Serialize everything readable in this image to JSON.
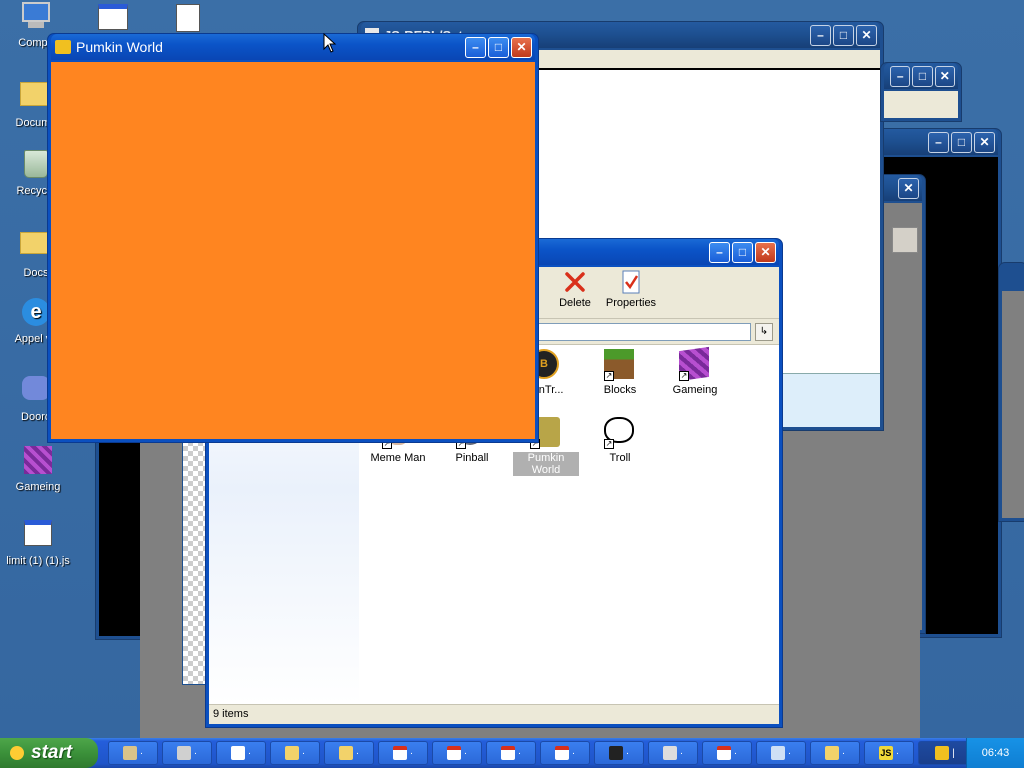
{
  "desktop": {
    "icons": [
      {
        "label": "Compu",
        "icon": "computer-icon"
      },
      {
        "label": "Docume",
        "icon": "documents-folder-icon"
      },
      {
        "label": "Recycle",
        "icon": "recycle-bin-icon"
      },
      {
        "label": "Docs",
        "icon": "folder-icon"
      },
      {
        "label": "Appel v1",
        "icon": "browser-icon"
      },
      {
        "label": "Doord",
        "icon": "discord-icon"
      },
      {
        "label": "Gameing",
        "icon": "purple-cube-icon"
      },
      {
        "label": "limit (1) (1).js",
        "icon": "script-file-icon"
      }
    ]
  },
  "windows": {
    "pumkin": {
      "title": "Pumkin World",
      "fill_color": "#FF8520"
    },
    "js_repl": {
      "title": "JS-REPL/Set"
    },
    "explorer": {
      "toolbar": [
        {
          "label": "Delete",
          "icon": "delete-x-icon"
        },
        {
          "label": "Properties",
          "icon": "properties-icon"
        }
      ],
      "files": [
        {
          "label": "oonTr...",
          "icon": "b-logo-icon"
        },
        {
          "label": "Blocks",
          "icon": "grass-block-icon"
        },
        {
          "label": "Gameing",
          "icon": "purple-cube-icon"
        },
        {
          "label": "Meme Man",
          "icon": "meme-man-icon"
        },
        {
          "label": "Pinball",
          "icon": "pinball-icon"
        },
        {
          "label": "Pumkin World",
          "icon": "pumpkin-icon"
        },
        {
          "label": "Troll",
          "icon": "troll-face-icon"
        }
      ],
      "status": "9 items"
    }
  },
  "taskbar": {
    "start_label": "start",
    "clock": "06:43",
    "items": [
      "",
      "",
      "",
      "",
      "",
      "",
      "",
      "",
      "",
      "",
      "",
      "",
      "",
      "",
      "",
      "",
      ""
    ],
    "js_badge": "JS"
  }
}
